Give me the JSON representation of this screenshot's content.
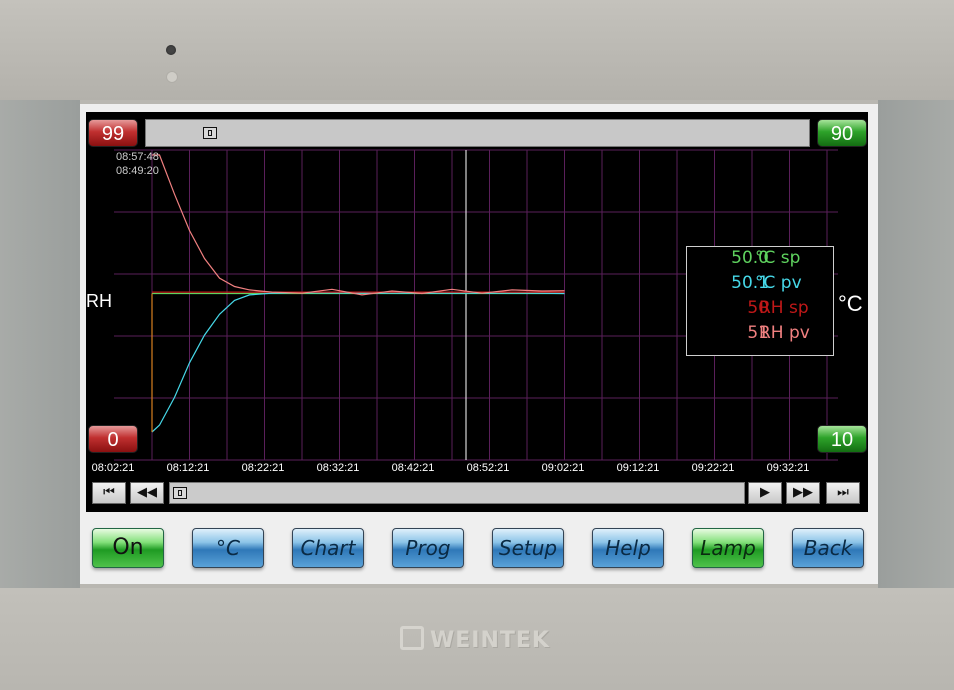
{
  "bezel": {
    "brand": "WEINTEK"
  },
  "scale": {
    "left_top": "99",
    "left_bottom": "0",
    "right_top": "90",
    "right_bottom": "10"
  },
  "axis": {
    "left_unit": "RH",
    "right_unit": "°C"
  },
  "cursor": {
    "time_1": "08:57:48",
    "time_2": "08:49:20"
  },
  "time_axis": [
    "08:02:21",
    "08:12:21",
    "08:22:21",
    "08:32:21",
    "08:42:21",
    "08:52:21",
    "09:02:21",
    "09:12:21",
    "09:22:21",
    "09:32:21"
  ],
  "legend": [
    {
      "value": "50.0",
      "name": "°C sp",
      "color": "#5fd35f"
    },
    {
      "value": "50.1",
      "name": "°C pv",
      "color": "#46d8e8"
    },
    {
      "value": "50",
      "name": "RH sp",
      "color": "#c01818"
    },
    {
      "value": "51",
      "name": "RH pv",
      "color": "#f08080"
    }
  ],
  "nav": {
    "first": "⏮",
    "back": "◀◀",
    "play": "▶",
    "forward": "▶▶",
    "last": "⏭"
  },
  "menu": [
    {
      "label": "On",
      "style": "green",
      "name": "on-button"
    },
    {
      "label": "°C",
      "style": "blue",
      "name": "celsius-button"
    },
    {
      "label": "Chart",
      "style": "blue",
      "name": "chart-button"
    },
    {
      "label": "Prog",
      "style": "blue",
      "name": "prog-button"
    },
    {
      "label": "Setup",
      "style": "blue",
      "name": "setup-button"
    },
    {
      "label": "Help",
      "style": "blue",
      "name": "help-button"
    },
    {
      "label": "Lamp",
      "style": "green",
      "name": "lamp-button"
    },
    {
      "label": "Back",
      "style": "blue",
      "name": "back-button"
    }
  ],
  "colors": {
    "grid": "#5a1f5a",
    "cursor_line": "#ffffff"
  },
  "chart_data": {
    "type": "line",
    "y_left_range": [
      0,
      99
    ],
    "y_right_range": [
      10,
      90
    ],
    "x_labels": [
      "08:02:21",
      "08:12:21",
      "08:22:21",
      "08:32:21",
      "08:42:21",
      "08:52:21",
      "09:02:21",
      "09:12:21",
      "09:22:21",
      "09:32:21"
    ],
    "cursor_time": "08:57:48",
    "series": [
      {
        "name": "°C sp",
        "axis": "right",
        "color": "#5fd35f",
        "points": [
          [
            0,
            50
          ],
          [
            0.8,
            50
          ],
          [
            55,
            50
          ]
        ]
      },
      {
        "name": "°C pv",
        "axis": "right",
        "color": "#46d8e8",
        "points": [
          [
            0,
            10
          ],
          [
            1,
            12
          ],
          [
            3,
            20
          ],
          [
            5,
            30
          ],
          [
            7,
            38
          ],
          [
            9,
            44
          ],
          [
            11,
            48
          ],
          [
            13,
            49.6
          ],
          [
            16,
            50.1
          ],
          [
            20,
            50.2
          ],
          [
            30,
            50.1
          ],
          [
            40,
            50.1
          ],
          [
            50,
            50.1
          ],
          [
            55,
            50.0
          ]
        ]
      },
      {
        "name": "RH sp",
        "axis": "left",
        "color": "#c01818",
        "points": [
          [
            0,
            50
          ],
          [
            0.8,
            50
          ],
          [
            55,
            50
          ]
        ]
      },
      {
        "name": "RH pv",
        "axis": "left",
        "color": "#f08080",
        "points": [
          [
            0,
            99
          ],
          [
            1,
            99
          ],
          [
            3,
            85
          ],
          [
            5,
            72
          ],
          [
            7,
            62
          ],
          [
            9,
            55
          ],
          [
            11,
            52
          ],
          [
            13,
            50.8
          ],
          [
            16,
            50
          ],
          [
            20,
            49.6
          ],
          [
            24,
            51
          ],
          [
            28,
            49
          ],
          [
            32,
            50.4
          ],
          [
            36,
            49.5
          ],
          [
            40,
            51
          ],
          [
            44,
            49.6
          ],
          [
            48,
            50.8
          ],
          [
            52,
            50.4
          ],
          [
            55,
            50.5
          ]
        ]
      }
    ]
  }
}
